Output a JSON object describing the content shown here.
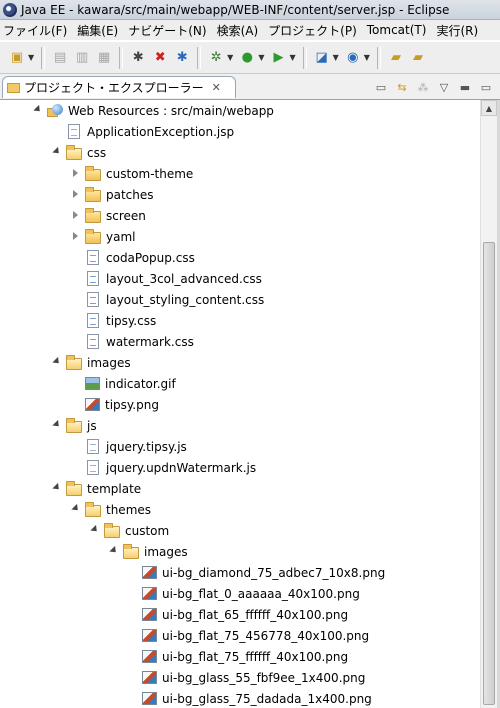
{
  "window": {
    "title": "Java EE - kawara/src/main/webapp/WEB-INF/content/server.jsp - Eclipse"
  },
  "menubar": {
    "items": [
      "ファイル(F)",
      "編集(E)",
      "ナビゲート(N)",
      "検索(A)",
      "プロジェクト(P)",
      "Tomcat(T)",
      "実行(R)"
    ]
  },
  "toolbar": {
    "buttons": [
      "new-icon",
      "save-icon",
      "save-all-icon",
      "print-icon",
      "bug-icon",
      "bug-delete-icon",
      "bug-refresh-icon",
      "debug-icon",
      "run-icon",
      "external-tools-icon",
      "new-server-icon",
      "new-service-icon",
      "open-folder-icon",
      "open-type-icon"
    ]
  },
  "view": {
    "tab_label": "プロジェクト・エクスプローラー",
    "close_glyph": "✕"
  },
  "tree": {
    "items": [
      {
        "label": "Web Resources : src/main/webapp",
        "type": "webres",
        "level": 0,
        "expanded": true
      },
      {
        "label": "ApplicationException.jsp",
        "type": "file",
        "level": 1
      },
      {
        "label": "css",
        "type": "folder",
        "level": 1,
        "expanded": true
      },
      {
        "label": "custom-theme",
        "type": "folder",
        "level": 2,
        "expanded": false
      },
      {
        "label": "patches",
        "type": "folder",
        "level": 2,
        "expanded": false
      },
      {
        "label": "screen",
        "type": "folder",
        "level": 2,
        "expanded": false
      },
      {
        "label": "yaml",
        "type": "folder",
        "level": 2,
        "expanded": false
      },
      {
        "label": "codaPopup.css",
        "type": "css",
        "level": 2
      },
      {
        "label": "layout_3col_advanced.css",
        "type": "css",
        "level": 2
      },
      {
        "label": "layout_styling_content.css",
        "type": "css",
        "level": 2
      },
      {
        "label": "tipsy.css",
        "type": "css",
        "level": 2
      },
      {
        "label": "watermark.css",
        "type": "css",
        "level": 2
      },
      {
        "label": "images",
        "type": "folder",
        "level": 1,
        "expanded": true
      },
      {
        "label": "indicator.gif",
        "type": "gif",
        "level": 2
      },
      {
        "label": "tipsy.png",
        "type": "img",
        "level": 2
      },
      {
        "label": "js",
        "type": "folder",
        "level": 1,
        "expanded": true
      },
      {
        "label": "jquery.tipsy.js",
        "type": "file",
        "level": 2
      },
      {
        "label": "jquery.updnWatermark.js",
        "type": "file",
        "level": 2
      },
      {
        "label": "template",
        "type": "folder",
        "level": 1,
        "expanded": true
      },
      {
        "label": "themes",
        "type": "folder",
        "level": 2,
        "expanded": true
      },
      {
        "label": "custom",
        "type": "folder",
        "level": 3,
        "expanded": true
      },
      {
        "label": "images",
        "type": "folder",
        "level": 4,
        "expanded": true
      },
      {
        "label": "ui-bg_diamond_75_adbec7_10x8.png",
        "type": "img",
        "level": 5
      },
      {
        "label": "ui-bg_flat_0_aaaaaa_40x100.png",
        "type": "img",
        "level": 5
      },
      {
        "label": "ui-bg_flat_65_ffffff_40x100.png",
        "type": "img",
        "level": 5
      },
      {
        "label": "ui-bg_flat_75_456778_40x100.png",
        "type": "img",
        "level": 5
      },
      {
        "label": "ui-bg_flat_75_ffffff_40x100.png",
        "type": "img",
        "level": 5
      },
      {
        "label": "ui-bg_glass_55_fbf9ee_1x400.png",
        "type": "img",
        "level": 5
      },
      {
        "label": "ui-bg_glass_75_dadada_1x400.png",
        "type": "img",
        "level": 5
      }
    ]
  }
}
